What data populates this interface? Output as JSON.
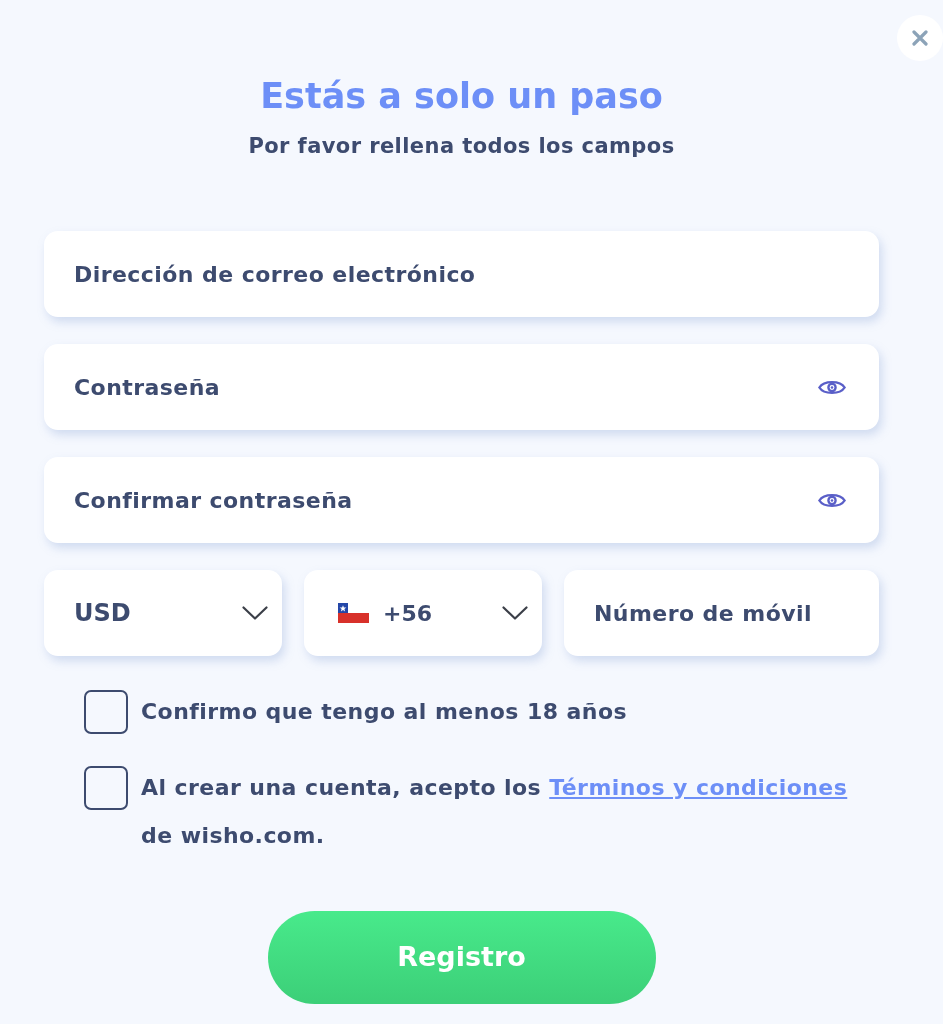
{
  "title": "Estás a solo un paso",
  "subtitle": "Por favor rellena todos los campos",
  "fields": [
    {
      "kind": "email",
      "placeholder": "Dirección de correo electrónico"
    },
    {
      "kind": "password",
      "placeholder": "Contraseña"
    },
    {
      "kind": "password",
      "placeholder": "Confirmar contraseña"
    }
  ],
  "currency": {
    "value": "USD"
  },
  "phone": {
    "code": "+56",
    "placeholder": "Número de móvil"
  },
  "checkboxes": [
    {
      "kind": "plain",
      "label": "Confirmo que tengo al menos 18 años",
      "checked": false
    },
    {
      "kind": "terms",
      "label": "Al crear una cuenta, acepto los",
      "link": "Términos y condiciones",
      "label_after": "de wisho.com.",
      "checked": false
    }
  ],
  "submit": {
    "label": "Registro"
  }
}
